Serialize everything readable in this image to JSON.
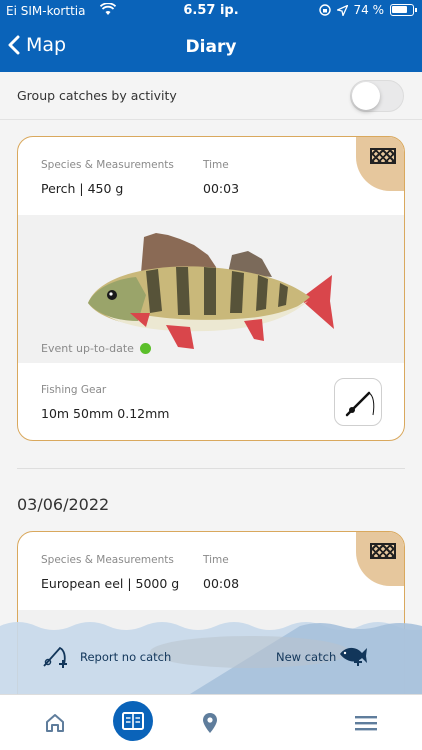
{
  "status_bar": {
    "carrier": "Ei SIM-korttia",
    "time": "6.57 ip.",
    "battery": "74 %"
  },
  "nav": {
    "back_label": "Map",
    "title": "Diary"
  },
  "group_row": {
    "label": "Group catches by activity",
    "toggle_on": false
  },
  "catches": [
    {
      "species_label": "Species & Measurements",
      "species_value": "Perch | 450 g",
      "time_label": "Time",
      "time_value": "00:03",
      "event_status": "Event up-to-date",
      "gear_label": "Fishing Gear",
      "gear_value": "10m 50mm 0.12mm",
      "icon": "net-icon",
      "gear_icon": "fishing-rod-icon"
    },
    {
      "species_label": "Species & Measurements",
      "species_value": "European eel | 5000 g",
      "time_label": "Time",
      "time_value": "00:08",
      "icon": "net-icon"
    }
  ],
  "date_heading": "03/06/2022",
  "actions": {
    "report_no_catch": "Report no catch",
    "new_catch": "New catch"
  },
  "tabs": [
    {
      "name": "home",
      "icon": "home-icon"
    },
    {
      "name": "diary",
      "icon": "diary-icon",
      "active": true
    },
    {
      "name": "map",
      "icon": "map-pin-icon"
    },
    {
      "name": "menu",
      "icon": "menu-icon"
    }
  ],
  "colors": {
    "brand": "#0a63b9",
    "card_border": "#d9a85d",
    "corner": "#e6c79d",
    "status_ok": "#5bbf2a",
    "wave_light": "#c8d9ea",
    "wave_dark": "#a7c1dc"
  }
}
